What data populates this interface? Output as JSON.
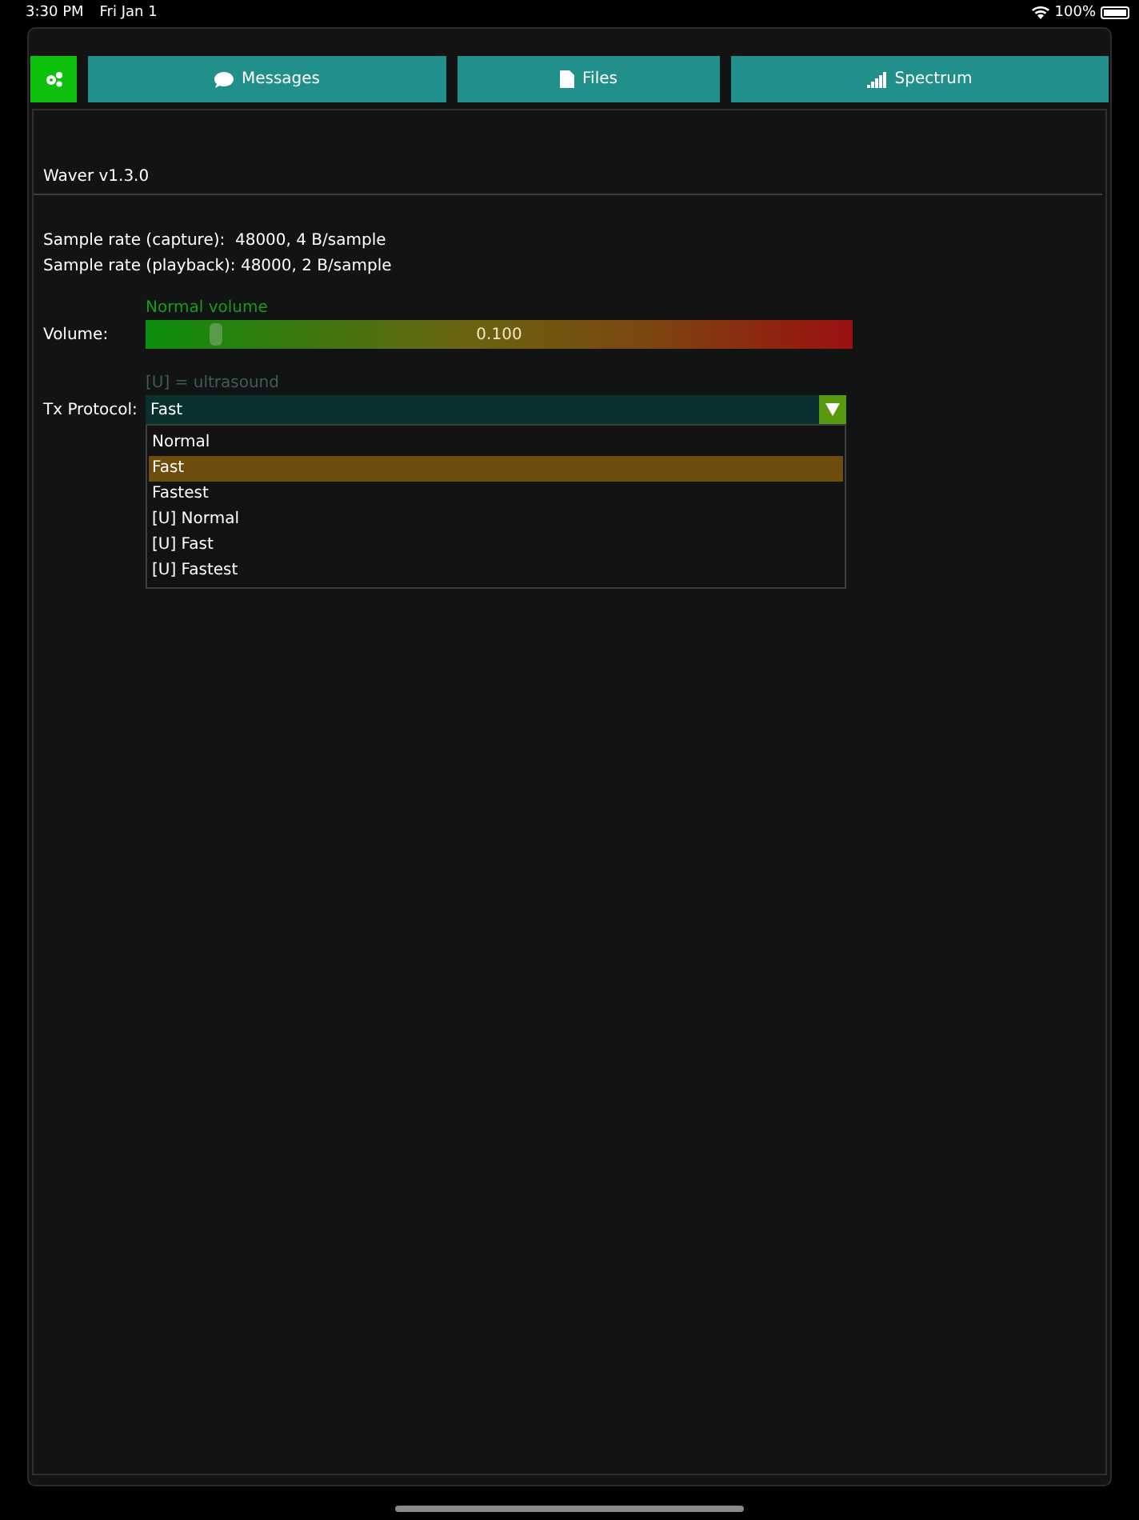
{
  "status_bar": {
    "time": "3:30 PM",
    "date": "Fri Jan 1",
    "battery": "100%"
  },
  "tabs": [
    {
      "kind": "settings",
      "selected": true
    },
    {
      "kind": "messages",
      "label": "Messages",
      "selected": false
    },
    {
      "kind": "files",
      "label": "Files",
      "selected": false
    },
    {
      "kind": "spectrum",
      "label": "Spectrum",
      "selected": false
    }
  ],
  "header": {
    "title": "Waver v1.3.0"
  },
  "info_lines": [
    "Sample rate (capture):  48000, 4 B/sample",
    "Sample rate (playback): 48000, 2 B/sample"
  ],
  "volume": {
    "hint": "Normal volume",
    "label": "Volume:",
    "level": 0.1,
    "reading": "0.100"
  },
  "protocol": {
    "hint": "[U] = ultrasound",
    "label": "Tx Protocol:",
    "value": "Fast",
    "expanded": true,
    "options": [
      {
        "label": "Normal",
        "selected": false
      },
      {
        "label": "Fast",
        "selected": true
      },
      {
        "label": "Fastest",
        "selected": false
      },
      {
        "label": "[U] Normal",
        "selected": false
      },
      {
        "label": "[U] Fast",
        "selected": false
      },
      {
        "label": "[U] Fastest",
        "selected": false
      }
    ]
  }
}
